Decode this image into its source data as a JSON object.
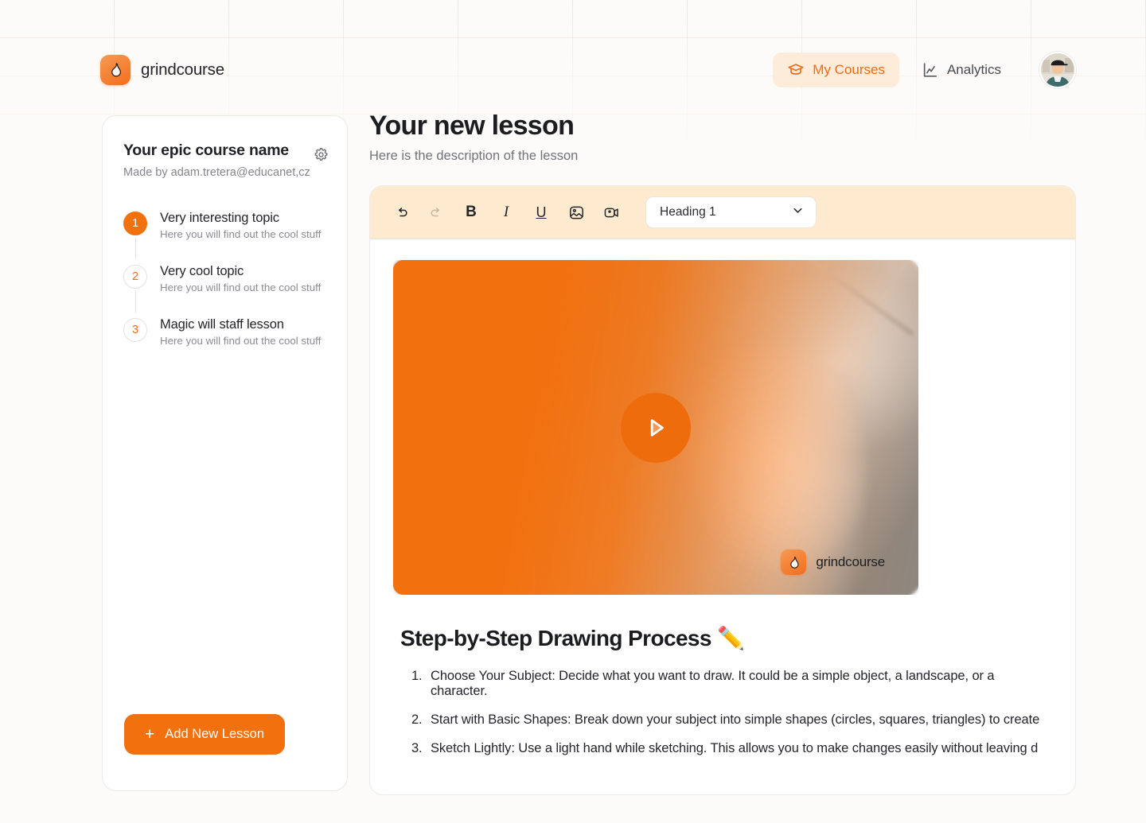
{
  "brand": {
    "name": "grindcourse",
    "icon": "flame-icon",
    "accent": "#F2700E"
  },
  "header": {
    "nav": [
      {
        "label": "My Courses",
        "icon": "graduation-cap-icon",
        "active": true
      },
      {
        "label": "Analytics",
        "icon": "chart-line-icon",
        "active": false
      }
    ],
    "avatar_alt": "user-avatar"
  },
  "sidebar": {
    "course_title": "Your epic course name",
    "course_author": "Made by adam.tretera@educanet,cz",
    "settings_icon": "gear-icon",
    "lessons": [
      {
        "number": "1",
        "title": "Very interesting topic",
        "subtitle": "Here you will find out the cool stuff",
        "active": true
      },
      {
        "number": "2",
        "title": "Very cool topic",
        "subtitle": "Here you will find out the cool stuff",
        "active": false
      },
      {
        "number": "3",
        "title": "Magic will  staff lesson",
        "subtitle": "Here you will find out the cool stuff",
        "active": false
      }
    ],
    "add_lesson_label": "Add New Lesson",
    "add_lesson_plus": "+"
  },
  "main": {
    "lesson_title": "Your new lesson",
    "lesson_description": "Here is the description of the lesson",
    "toolbar": {
      "undo": {
        "icon": "undo-arrow-icon",
        "label": "↶",
        "disabled": false
      },
      "redo": {
        "icon": "redo-arrow-icon",
        "label": "↷",
        "disabled": true
      },
      "bold": {
        "icon": "bold-icon",
        "label": "B"
      },
      "italic": {
        "icon": "italic-icon",
        "label": "I"
      },
      "underline": {
        "icon": "underline-icon",
        "label": "U"
      },
      "image": {
        "icon": "image-icon"
      },
      "video": {
        "icon": "video-camera-icon"
      },
      "heading_select": {
        "value": "Heading 1",
        "chevron": "chevron-down-icon"
      }
    },
    "video": {
      "play_icon": "play-icon",
      "watermark_text": "grindcourse",
      "watermark_icon": "flame-icon"
    },
    "content_heading": "Step-by-Step Drawing Process ✏️",
    "content_list": [
      "Choose Your Subject: Decide what you want to draw. It could be a simple object, a landscape, or a character.",
      "Start with Basic Shapes: Break down your subject into simple shapes (circles, squares, triangles) to create",
      "Sketch Lightly: Use a light hand while sketching. This allows you to make changes easily without leaving d"
    ]
  }
}
